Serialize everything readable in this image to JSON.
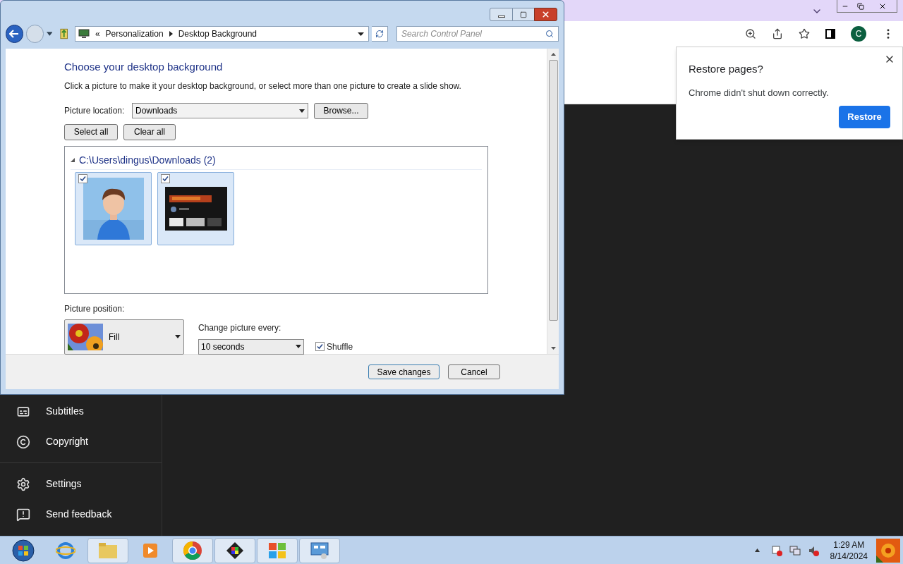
{
  "browser": {
    "avatar_letter": "C",
    "sidebar_items": [
      {
        "kind": "subtitles",
        "label": "Subtitles"
      },
      {
        "kind": "copyright",
        "label": "Copyright"
      },
      {
        "kind": "settings",
        "label": "Settings"
      },
      {
        "kind": "feedback",
        "label": "Send feedback"
      }
    ],
    "restore_popup": {
      "title": "Restore pages?",
      "message": "Chrome didn't shut down correctly.",
      "button": "Restore"
    }
  },
  "window": {
    "breadcrumb_prefix": "«",
    "breadcrumb": [
      "Personalization",
      "Desktop Background"
    ],
    "search": {
      "placeholder": "Search Control Panel"
    },
    "heading": "Choose your desktop background",
    "description": "Click a picture to make it your desktop background, or select more than one picture to create a slide show.",
    "picture_location": {
      "label": "Picture location:",
      "value": "Downloads"
    },
    "browse_button": "Browse...",
    "select_all_button": "Select all",
    "clear_all_button": "Clear all",
    "group": {
      "title": "C:\\Users\\dingus\\Downloads (2)",
      "expanded": true,
      "pictures": [
        {
          "kind": "figure",
          "checked": true
        },
        {
          "kind": "screenshot",
          "checked": true
        }
      ]
    },
    "picture_position": {
      "label": "Picture position:",
      "value": "Fill"
    },
    "change_every": {
      "label": "Change picture every:",
      "value": "10 seconds"
    },
    "shuffle": {
      "label": "Shuffle",
      "checked": true
    },
    "buttons": [
      "Save changes",
      "Cancel"
    ]
  },
  "taskbar": {
    "time": "1:29 AM",
    "date": "8/14/2024"
  }
}
